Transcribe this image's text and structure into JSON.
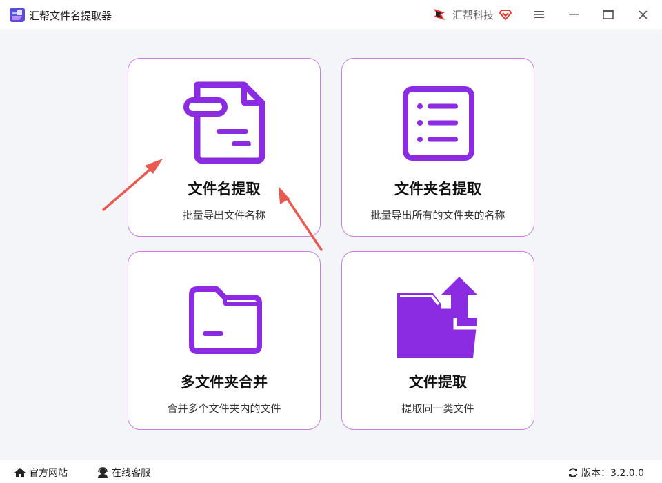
{
  "window": {
    "title": "汇帮文件名提取器",
    "brand": "汇帮科技"
  },
  "colors": {
    "accent": "#8b2be2",
    "card_border": "#c77fe0",
    "arrow": "#e85a50",
    "background": "#f4f5f9"
  },
  "cards": [
    {
      "title": "文件名提取",
      "subtitle": "批量导出文件名称",
      "icon": "file-icon"
    },
    {
      "title": "文件夹名提取",
      "subtitle": "批量导出所有的文件夹的名称",
      "icon": "list-icon"
    },
    {
      "title": "多文件夹合并",
      "subtitle": "合并多个文件夹内的文件",
      "icon": "folder-icon"
    },
    {
      "title": "文件提取",
      "subtitle": "提取同一类文件",
      "icon": "folder-upload-icon"
    }
  ],
  "footer": {
    "website": "官方网站",
    "support": "在线客服",
    "version": "版本：3.2.0.0"
  }
}
